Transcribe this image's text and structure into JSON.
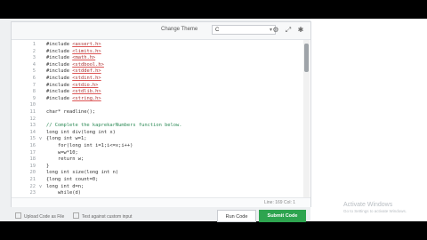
{
  "toolbar": {
    "theme_label": "Change Theme",
    "language_value": "C",
    "icons": [
      "settings-icon",
      "expand-icon",
      "gear-icon"
    ]
  },
  "editor": {
    "lines": [
      {
        "n": "1",
        "fold": "",
        "text": "#include ",
        "hdr": "<assert.h>",
        "kind": "inc"
      },
      {
        "n": "2",
        "fold": "",
        "text": "#include ",
        "hdr": "<limits.h>",
        "kind": "inc"
      },
      {
        "n": "3",
        "fold": "",
        "text": "#include ",
        "hdr": "<math.h>",
        "kind": "inc"
      },
      {
        "n": "4",
        "fold": "",
        "text": "#include ",
        "hdr": "<stdbool.h>",
        "kind": "inc"
      },
      {
        "n": "5",
        "fold": "",
        "text": "#include ",
        "hdr": "<stddef.h>",
        "kind": "inc"
      },
      {
        "n": "6",
        "fold": "",
        "text": "#include ",
        "hdr": "<stdint.h>",
        "kind": "inc"
      },
      {
        "n": "7",
        "fold": "",
        "text": "#include ",
        "hdr": "<stdio.h>",
        "kind": "inc"
      },
      {
        "n": "8",
        "fold": "",
        "text": "#include ",
        "hdr": "<stdlib.h>",
        "kind": "inc"
      },
      {
        "n": "9",
        "fold": "",
        "text": "#include ",
        "hdr": "<string.h>",
        "kind": "inc"
      },
      {
        "n": "10",
        "fold": "",
        "text": "",
        "hdr": "",
        "kind": "code"
      },
      {
        "n": "11",
        "fold": "",
        "text": "char* readline();",
        "hdr": "",
        "kind": "code"
      },
      {
        "n": "12",
        "fold": "",
        "text": "",
        "hdr": "",
        "kind": "code"
      },
      {
        "n": "13",
        "fold": "",
        "text": "// Complete the kaprekarNumbers function below.",
        "hdr": "",
        "kind": "comment"
      },
      {
        "n": "14",
        "fold": "",
        "text": "long int div(long int x)",
        "hdr": "",
        "kind": "code"
      },
      {
        "n": "15",
        "fold": "v",
        "text": "{long int w=1;",
        "hdr": "",
        "kind": "code"
      },
      {
        "n": "16",
        "fold": "",
        "text": "    for(long int i=1;i<=x;i++)",
        "hdr": "",
        "kind": "code"
      },
      {
        "n": "17",
        "fold": "",
        "text": "    w=w*10;",
        "hdr": "",
        "kind": "code"
      },
      {
        "n": "18",
        "fold": "",
        "text": "    return w;",
        "hdr": "",
        "kind": "code"
      },
      {
        "n": "19",
        "fold": "",
        "text": "}",
        "hdr": "",
        "kind": "code"
      },
      {
        "n": "20",
        "fold": "",
        "text": "long int size(long int n)",
        "hdr": "",
        "kind": "code"
      },
      {
        "n": "21",
        "fold": "",
        "text": "{long int count=0;",
        "hdr": "",
        "kind": "code"
      },
      {
        "n": "22",
        "fold": "v",
        "text": "long int d=n;",
        "hdr": "",
        "kind": "code"
      },
      {
        "n": "23",
        "fold": "",
        "text": "    while(d)",
        "hdr": "",
        "kind": "code"
      }
    ]
  },
  "status": {
    "cursor": "Line: 169 Col: 1"
  },
  "footer": {
    "upload_label": "Upload Code as File",
    "test_label": "Test against custom input",
    "run_label": "Run Code",
    "submit_label": "Submit Code"
  },
  "watermark": {
    "title": "Activate Windows",
    "subtitle": "Go to Settings to activate Windows."
  }
}
